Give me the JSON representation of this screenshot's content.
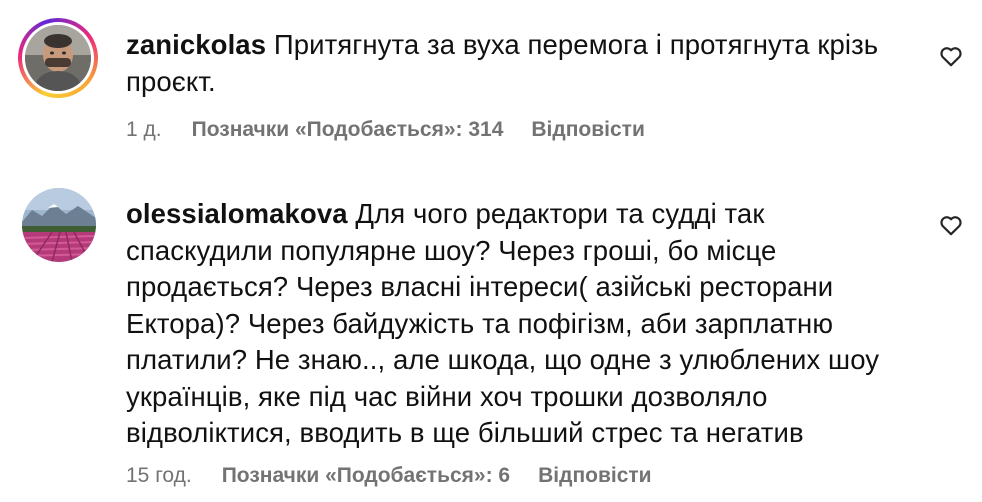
{
  "comments": [
    {
      "username": "zanickolas",
      "text": "Притягнута за вуха перемога і протягнута крізь проєкт.",
      "time": "1 д.",
      "likes": "Позначки «Подобається»: 314",
      "reply": "Відповісти",
      "avatar": "profile-photo-man",
      "has_story_ring": true
    },
    {
      "username": "olessialomakova",
      "text": "Для чого редактори та судді так спаскудили популярне шоу? Через гроші, бо місце продається? Через власні інтереси( азійські ресторани Ектора)? Через байдужість та пофігізм, аби зарплатню платили? Не знаю.., але шкода, що одне з улюблених шоу українців, яке під час війни хоч трошки дозволяло відволіктися, вводить в ще більший стрес та негатив",
      "time": "15 год.",
      "likes": "Позначки «Подобається»: 6",
      "reply": "Відповісти",
      "avatar": "profile-photo-tulip-field",
      "has_story_ring": false
    }
  ],
  "icons": {
    "like": "heart-outline-icon"
  },
  "colors": {
    "text": "#111111",
    "meta": "#737373",
    "background": "#ffffff"
  }
}
